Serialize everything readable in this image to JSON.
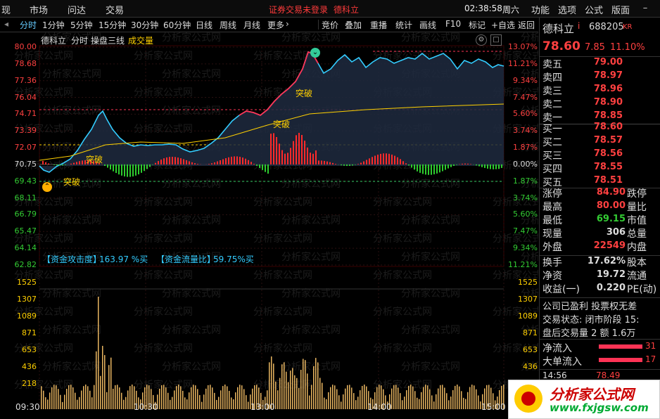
{
  "menubar": {
    "items": [
      "现",
      "市场",
      "问达",
      "交易"
    ],
    "notice": "证券交易未登录",
    "notice_stock": "德科立",
    "clock": "02:38:58",
    "weekday": "周六",
    "right_items": [
      "功能",
      "选项",
      "公式",
      "版面"
    ],
    "win_icons": [
      "minimize-icon",
      "maximize-icon",
      "close-icon"
    ]
  },
  "toolbar": {
    "periods": [
      "分时",
      "1分钟",
      "5分钟",
      "15分钟",
      "30分钟",
      "60分钟",
      "日线",
      "周线",
      "月线",
      "更多"
    ],
    "active_index": 0,
    "more_arrow": "›",
    "right_items": [
      "竞价",
      "叠加",
      "重播",
      "统计",
      "画线",
      "F10",
      "标记",
      "+自选",
      "返回"
    ]
  },
  "chart_header": {
    "name": "德科立",
    "mode": "分时",
    "indicator": "操盘三线",
    "volume_label": "成交量"
  },
  "price_axis": {
    "left": [
      "80.00",
      "78.68",
      "77.36",
      "76.04",
      "74.71",
      "73.39",
      "72.07",
      "70.75",
      "69.43",
      "68.11",
      "66.79",
      "65.47",
      "64.14",
      "62.82"
    ],
    "right": [
      "13.07%",
      "11.21%",
      "9.34%",
      "7.47%",
      "5.60%",
      "3.74%",
      "1.87%",
      "0.00%",
      "1.87%",
      "3.74%",
      "5.60%",
      "7.47%",
      "9.34%",
      "11.21%"
    ]
  },
  "signals": {
    "breakout": "突破"
  },
  "fund_indicator": {
    "attack_label": "【资金攻击度】",
    "attack_value": "163.97 %买",
    "flow_label": "【资金流量比】",
    "flow_value": "59.75%买"
  },
  "volume_axis": [
    "1525",
    "1307",
    "1089",
    "871",
    "653",
    "436",
    "218"
  ],
  "time_axis": [
    "09:30",
    "10:30",
    "13:00",
    "14:00",
    "15:00"
  ],
  "quote": {
    "name": "德科立",
    "flag": "i",
    "code": "688205",
    "market": "KR",
    "price": "78.60",
    "change": "7.85",
    "pct": "11.10%",
    "asks": [
      {
        "label": "卖五",
        "price": "79.00"
      },
      {
        "label": "卖四",
        "price": "78.97"
      },
      {
        "label": "卖三",
        "price": "78.96"
      },
      {
        "label": "卖二",
        "price": "78.90"
      },
      {
        "label": "卖一",
        "price": "78.85"
      }
    ],
    "bids": [
      {
        "label": "买一",
        "price": "78.60"
      },
      {
        "label": "买二",
        "price": "78.57"
      },
      {
        "label": "买三",
        "price": "78.56"
      },
      {
        "label": "买四",
        "price": "78.55"
      },
      {
        "label": "买五",
        "price": "78.51"
      }
    ],
    "stats": [
      {
        "label": "涨停",
        "value": "84.90",
        "label2": "跌停",
        "color": "#ff4040"
      },
      {
        "label": "最高",
        "value": "80.00",
        "label2": "量比",
        "color": "#ff4040"
      },
      {
        "label": "最低",
        "value": "69.15",
        "label2": "市值",
        "color": "#33cc33"
      },
      {
        "label": "现量",
        "value": "306",
        "label2": "总量",
        "color": "#dddddd"
      },
      {
        "label": "外盘",
        "value": "22549",
        "label2": "内盘",
        "color": "#ff4040"
      }
    ],
    "stats2": [
      {
        "label": "换手",
        "value": "17.62%",
        "label2": "股本"
      },
      {
        "label": "净资",
        "value": "19.72",
        "label2": "流通"
      },
      {
        "label": "收益(一)",
        "value": "0.220",
        "label2": "PE(动)"
      }
    ],
    "info": [
      "公司已盈利 投票权无差",
      "交易状态: 闭市阶段 15:",
      "盘后交易量 2 额 1.6万"
    ],
    "flow": [
      {
        "label": "净流入",
        "value": "31"
      },
      {
        "label": "大单流入",
        "value": "17"
      }
    ],
    "tick": {
      "time": "14:56",
      "price": "78.49"
    }
  },
  "watermark": "分析家公式网",
  "logo": {
    "title": "分析家公式网",
    "url": "www.fxjgsw.com"
  }
}
